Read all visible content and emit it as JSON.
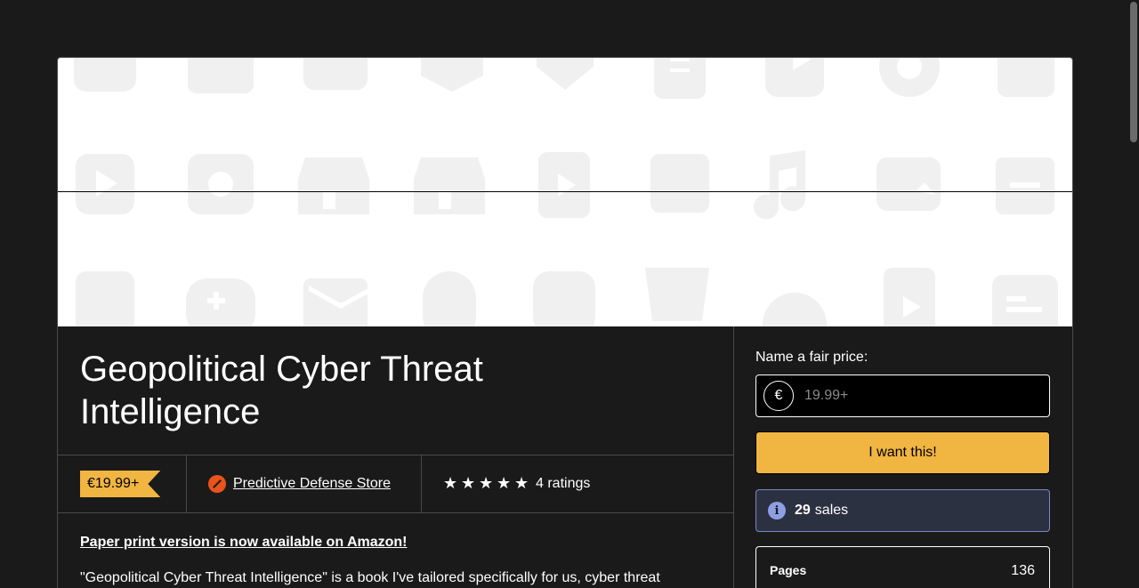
{
  "product": {
    "title_line1": "Geopolitical Cyber Threat",
    "title_line2": "Intelligence",
    "price_badge": "€19.99+",
    "seller_name": "Predictive Defense Store",
    "star_count": 5,
    "ratings_text": "4 ratings"
  },
  "description": {
    "amazon_link": "Paper print version is now available on Amazon!",
    "intro": "\"Geopolitical Cyber Threat Intelligence\" is a book I've tailored specifically for us, cyber threat"
  },
  "purchase": {
    "fair_price_label": "Name a fair price:",
    "currency_symbol": "€",
    "price_placeholder": "19.99+",
    "buy_button": "I want this!",
    "sales_count": "29",
    "sales_label": "sales"
  },
  "details": {
    "pages_label": "Pages",
    "pages_value": "136"
  },
  "colors": {
    "accent": "#f1b541",
    "background": "#1a1a1a",
    "info_box": "#2c3142",
    "info_icon": "#8f9de3"
  }
}
